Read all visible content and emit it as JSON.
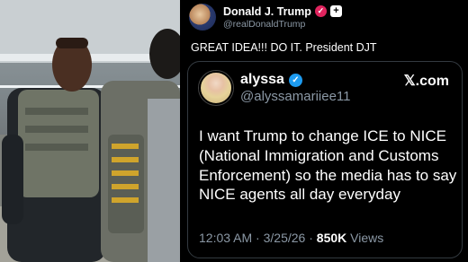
{
  "post": {
    "author_name": "Donald J. Trump",
    "author_handle": "@realDonaldTrump",
    "text": "GREAT IDEA!!! DO IT. President DJT",
    "badge_icon": "verified-badge-icon",
    "plus_icon": "plus-icon"
  },
  "quoted_post": {
    "author_name": "alyssa",
    "author_handle": "@alyssamariiee11",
    "source_label": "𝕏.com",
    "text": "I want Trump to change ICE to NICE (National Immigration and Customs Enforcement) so the media has to say NICE agents all day everyday",
    "time": "12:03 AM",
    "separator": "·",
    "date": "3/25/26",
    "views_count": "850K",
    "views_label": "Views",
    "verified_color": "#1d9bf0"
  },
  "colors": {
    "background": "#000000",
    "muted_text": "#8b98a5",
    "border": "#333a40"
  }
}
